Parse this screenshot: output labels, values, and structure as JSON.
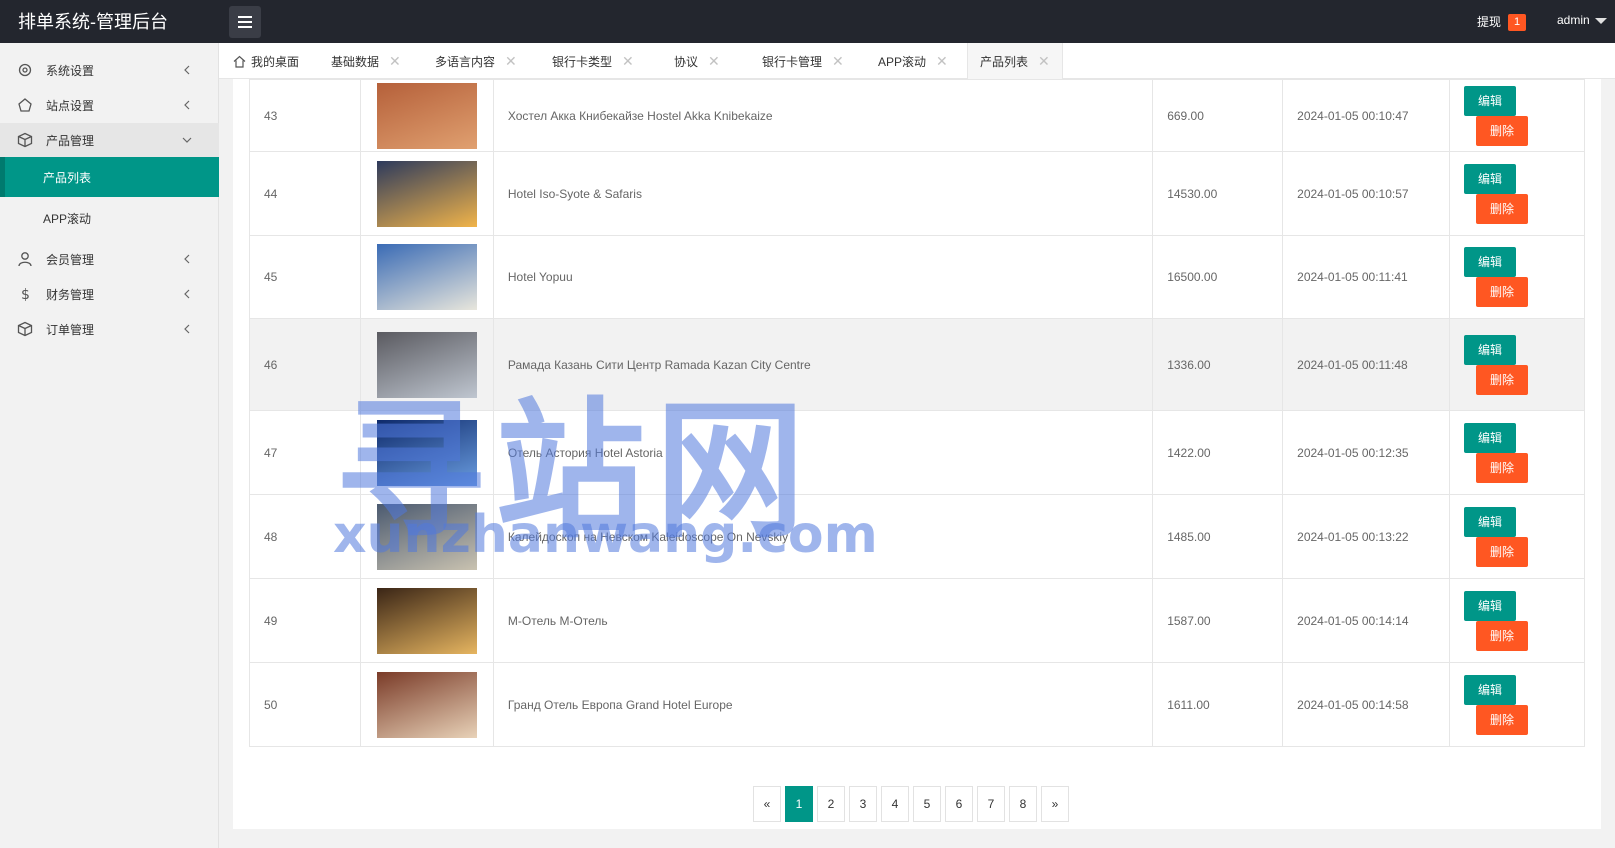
{
  "header": {
    "title": "排单系统-管理后台",
    "withdraw_label": "提现",
    "withdraw_badge": "1",
    "user": "admin"
  },
  "sidebar": {
    "items": [
      {
        "label": "系统设置",
        "icon": "gear-icon"
      },
      {
        "label": "站点设置",
        "icon": "site-icon"
      },
      {
        "label": "产品管理",
        "icon": "box-icon",
        "open": true,
        "children": [
          {
            "label": "产品列表",
            "active": true
          },
          {
            "label": "APP滚动"
          }
        ]
      },
      {
        "label": "会员管理",
        "icon": "user-icon"
      },
      {
        "label": "财务管理",
        "icon": "dollar-icon"
      },
      {
        "label": "订单管理",
        "icon": "box-icon"
      }
    ]
  },
  "tabs": [
    {
      "label": "我的桌面"
    },
    {
      "label": "基础数据"
    },
    {
      "label": "多语言内容"
    },
    {
      "label": "银行卡类型"
    },
    {
      "label": "协议"
    },
    {
      "label": "银行卡管理"
    },
    {
      "label": "APP滚动"
    },
    {
      "label": "产品列表",
      "active": true
    }
  ],
  "table": {
    "edit_label": "编辑",
    "delete_label": "删除",
    "rows": [
      {
        "id": "43",
        "name": "Хостел Акка Книбекайзе Hostel Akka Knibekaize",
        "price": "669.00",
        "time": "2024-01-05 00:10:47"
      },
      {
        "id": "44",
        "name": "Hotel Iso-Syote & Safaris",
        "price": "14530.00",
        "time": "2024-01-05 00:10:57"
      },
      {
        "id": "45",
        "name": "Hotel Yopuu",
        "price": "16500.00",
        "time": "2024-01-05 00:11:41"
      },
      {
        "id": "46",
        "name": "Рамада Казань Сити Центр Ramada Kazan City Centre",
        "price": "1336.00",
        "time": "2024-01-05 00:11:48"
      },
      {
        "id": "47",
        "name": "Отель Астория Hotel Astoria",
        "price": "1422.00",
        "time": "2024-01-05 00:12:35"
      },
      {
        "id": "48",
        "name": "Калейдоскоп на Невском Kaleidoscope On Nevskiy",
        "price": "1485.00",
        "time": "2024-01-05 00:13:22"
      },
      {
        "id": "49",
        "name": "М-Отель М-Отель",
        "price": "1587.00",
        "time": "2024-01-05 00:14:14"
      },
      {
        "id": "50",
        "name": "Гранд Отель Европа Grand Hotel Europe",
        "price": "1611.00",
        "time": "2024-01-05 00:14:58"
      }
    ]
  },
  "pagination": {
    "prev": "«",
    "pages": [
      "1",
      "2",
      "3",
      "4",
      "5",
      "6",
      "7",
      "8"
    ],
    "current": "1",
    "next": "»"
  },
  "watermark": {
    "line1": "寻站网",
    "line2": "xunzhanwang.com"
  },
  "colors": {
    "primary": "#009688",
    "danger": "#ff5722",
    "header_bg": "#23262e"
  }
}
